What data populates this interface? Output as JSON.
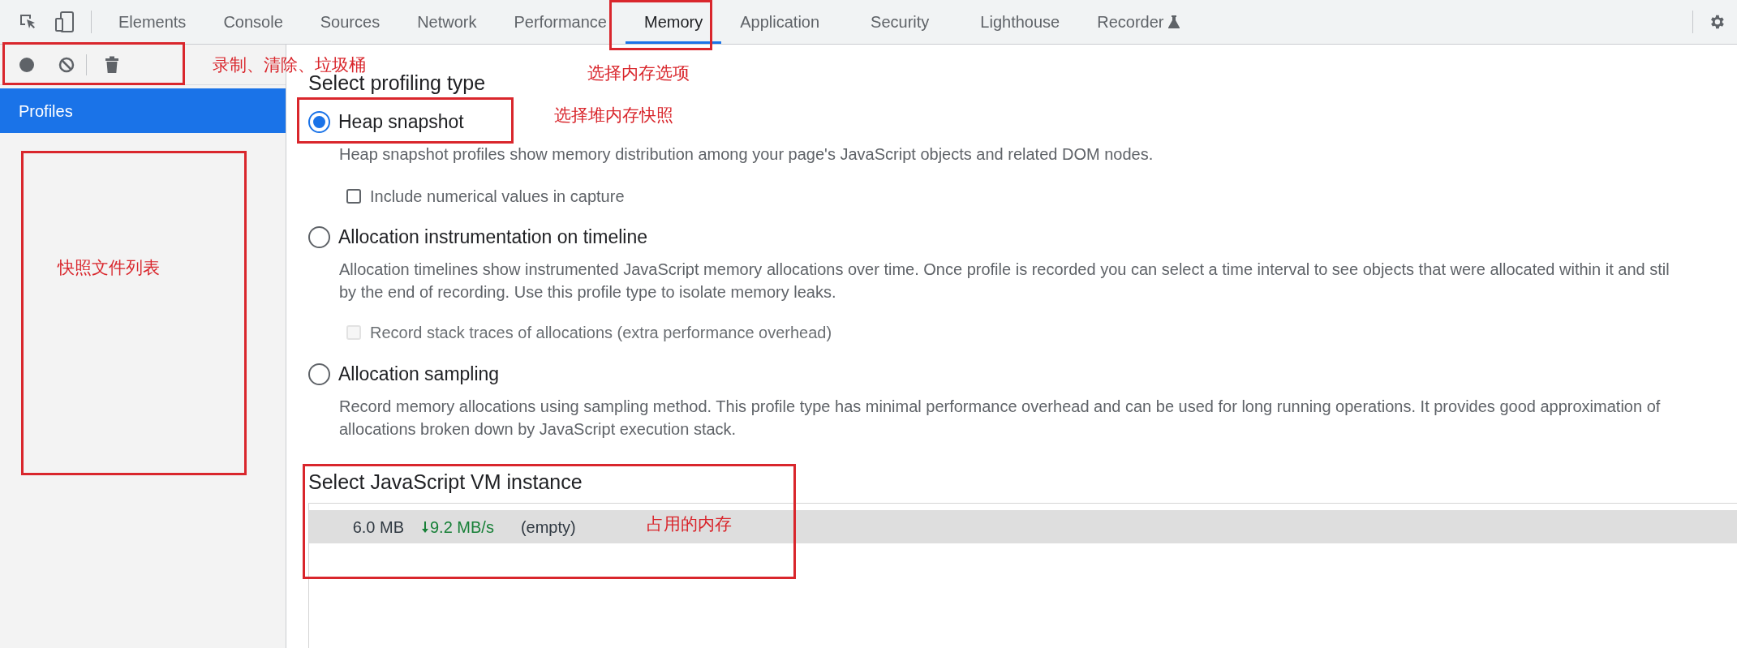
{
  "tabs": [
    {
      "label": "Elements",
      "selected": false
    },
    {
      "label": "Console",
      "selected": false
    },
    {
      "label": "Sources",
      "selected": false
    },
    {
      "label": "Network",
      "selected": false
    },
    {
      "label": "Performance",
      "selected": false
    },
    {
      "label": "Memory",
      "selected": true
    },
    {
      "label": "Application",
      "selected": false
    },
    {
      "label": "Security",
      "selected": false
    },
    {
      "label": "Lighthouse",
      "selected": false
    },
    {
      "label": "Recorder",
      "selected": false,
      "experimental": true
    }
  ],
  "sidebar": {
    "items": [
      {
        "label": "Profiles",
        "selected": true
      }
    ]
  },
  "profiling": {
    "title": "Select profiling type",
    "options": [
      {
        "label": "Heap snapshot",
        "selected": true,
        "description": [
          "Heap snapshot profiles show memory distribution among your page's JavaScript objects and related DOM nodes."
        ],
        "setting": {
          "label": "Include numerical values in capture",
          "checked": false,
          "disabled": false
        }
      },
      {
        "label": "Allocation instrumentation on timeline",
        "selected": false,
        "description": [
          "Allocation timelines show instrumented JavaScript memory allocations over time. Once profile is recorded you can select a time interval to see objects that were allocated within it and stil",
          "by the end of recording. Use this profile type to isolate memory leaks."
        ],
        "setting": {
          "label": "Record stack traces of allocations (extra performance overhead)",
          "checked": false,
          "disabled": true
        }
      },
      {
        "label": "Allocation sampling",
        "selected": false,
        "description": [
          "Record memory allocations using sampling method. This profile type has minimal performance overhead and can be used for long running operations. It provides good approximation of",
          "allocations broken down by JavaScript execution stack."
        ]
      }
    ]
  },
  "vm": {
    "title": "Select JavaScript VM instance",
    "instances": [
      {
        "size": "6.0 MB",
        "rate": "9.2 MB/s",
        "name": "(empty)",
        "selected": true
      }
    ]
  },
  "annotations": [
    {
      "kind": "frame"
    },
    {
      "kind": "note",
      "text": "录制、清除、垃圾桶"
    },
    {
      "kind": "frame"
    },
    {
      "kind": "note",
      "text": "选择内存选项"
    },
    {
      "kind": "frame"
    },
    {
      "kind": "note",
      "text": "选择堆内存快照"
    },
    {
      "kind": "frame"
    },
    {
      "kind": "note",
      "text": "快照文件列表"
    },
    {
      "kind": "frame"
    },
    {
      "kind": "note",
      "text": "占用的内存"
    }
  ]
}
